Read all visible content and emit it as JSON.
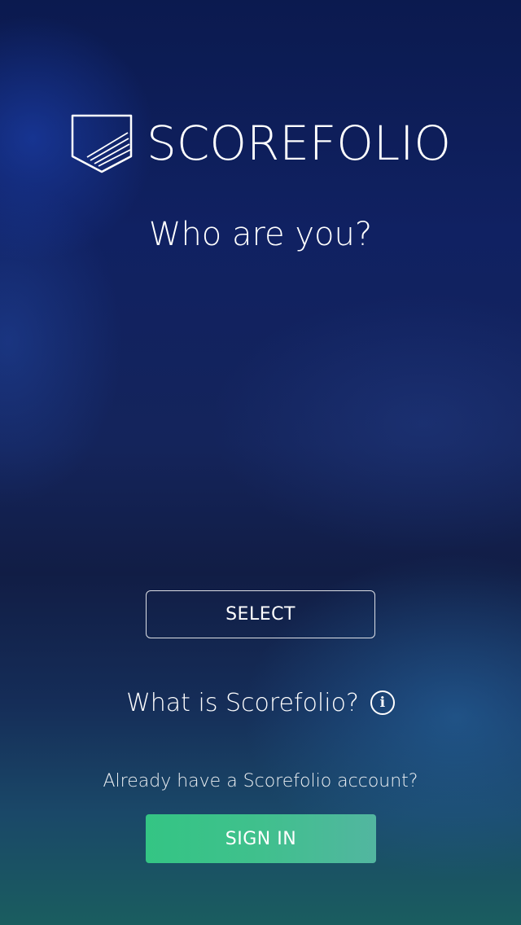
{
  "app": {
    "logo_text": "SCOREFOLIO"
  },
  "main": {
    "headline": "Who are you?",
    "select_label": "SELECT",
    "what_is_label": "What is Scorefolio?",
    "info_icon_glyph": "i",
    "account_prompt": "Already have a Scorefolio account?",
    "signin_label": "SIGN IN"
  },
  "icons": {
    "logo": "shield-icon",
    "info": "info-icon"
  },
  "colors": {
    "signin_start": "#34c584",
    "signin_end": "#52b6a0",
    "text": "#ffffff"
  }
}
